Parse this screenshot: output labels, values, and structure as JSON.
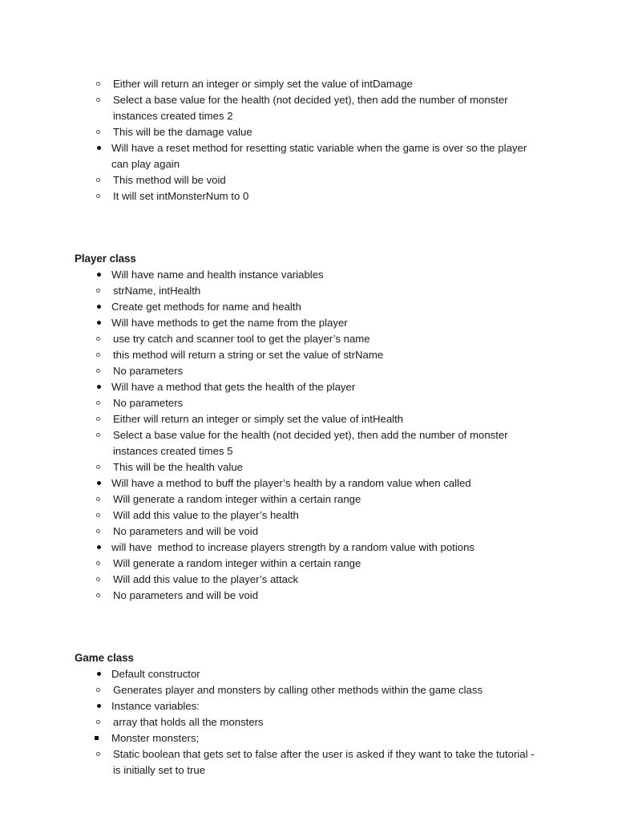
{
  "document": {
    "type": "outline-notes",
    "background_color": "#ffffff",
    "text_color": "#1a1a1a",
    "sections": [
      {
        "heading": null,
        "blocks": [
          {
            "level": 2,
            "text": "Either will return an integer or simply set the value of intDamage"
          },
          {
            "level": 2,
            "text": "Select a base value for the health (not decided yet), then add the number of monster instances created times 2"
          },
          {
            "level": 2,
            "text": "This will be the damage value"
          },
          {
            "level": 1,
            "text": "Will have a reset method for resetting static variable when the game is over so the player can play again"
          },
          {
            "level": 2,
            "text": "This method will be void"
          },
          {
            "level": 2,
            "text": "It will set intMonsterNum to 0"
          }
        ]
      },
      {
        "heading": "Player class",
        "blocks": [
          {
            "level": 1,
            "text": "Will have name and health instance variables"
          },
          {
            "level": 2,
            "text": "strName, intHealth"
          },
          {
            "level": 1,
            "text": "Create get methods for name and health"
          },
          {
            "level": 1,
            "text": "Will have methods to get the name from the player"
          },
          {
            "level": 2,
            "text": "use try catch and scanner tool to get the player’s name"
          },
          {
            "level": 2,
            "text": "this method will return a string or set the value of strName"
          },
          {
            "level": 2,
            "text": "No parameters"
          },
          {
            "level": 1,
            "text": "Will have a method that gets the health of the player"
          },
          {
            "level": 2,
            "text": "No parameters"
          },
          {
            "level": 2,
            "text": "Either will return an integer or simply set the value of intHealth"
          },
          {
            "level": 2,
            "text": "Select a base value for the health (not decided yet), then add the number of monster instances created times 5"
          },
          {
            "level": 2,
            "text": "This will be the health value"
          },
          {
            "level": 1,
            "text": "Will have a method to buff the player’s health by a random value when called"
          },
          {
            "level": 2,
            "text": "Will generate a random integer within a certain range"
          },
          {
            "level": 2,
            "text": "Will add this value to the player’s health"
          },
          {
            "level": 2,
            "text": "No parameters and will be void"
          },
          {
            "level": 1,
            "text": "will have  method to increase players strength by a random value with potions"
          },
          {
            "level": 2,
            "text": "Will generate a random integer within a certain range"
          },
          {
            "level": 2,
            "text": "Will add this value to the player’s attack"
          },
          {
            "level": 2,
            "text": "No parameters and will be void"
          }
        ]
      },
      {
        "heading": "Game class",
        "blocks": [
          {
            "level": 1,
            "text": "Default constructor"
          },
          {
            "level": 2,
            "text": "Generates player and monsters by calling other methods within the game class"
          },
          {
            "level": 1,
            "text": "Instance variables:"
          },
          {
            "level": 2,
            "text": "array that holds all the monsters"
          },
          {
            "level": 3,
            "text": "Monster monsters;"
          },
          {
            "level": 2,
            "text": "Static boolean that gets set to false after the user is asked if they want to take the tutorial - is initially set to true"
          }
        ]
      }
    ]
  }
}
